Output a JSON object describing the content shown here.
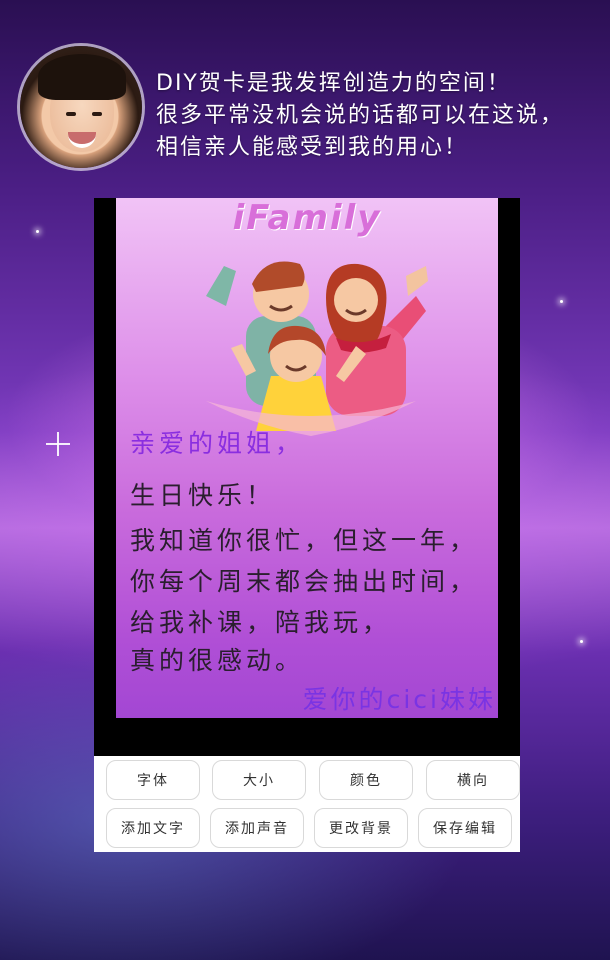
{
  "header": {
    "intro_lines": [
      "DIY贺卡是我发挥创造力的空间！",
      "很多平常没机会说的话都可以在这说，",
      "相信亲人能感受到我的用心！"
    ]
  },
  "card": {
    "brand": "iFamily",
    "lines": [
      "亲爱的姐姐，",
      "生日快乐！",
      "我知道你很忙，但这一年，",
      "你每个周末都会抽出时间，",
      "给我补课，陪我玩，",
      "真的很感动。"
    ],
    "signature": "爱你的cici妹妹"
  },
  "toolbar": {
    "row1": [
      "字体",
      "大小",
      "颜色",
      "横向"
    ],
    "row2": [
      "添加文字",
      "添加声音",
      "更改背景",
      "保存编辑"
    ]
  }
}
